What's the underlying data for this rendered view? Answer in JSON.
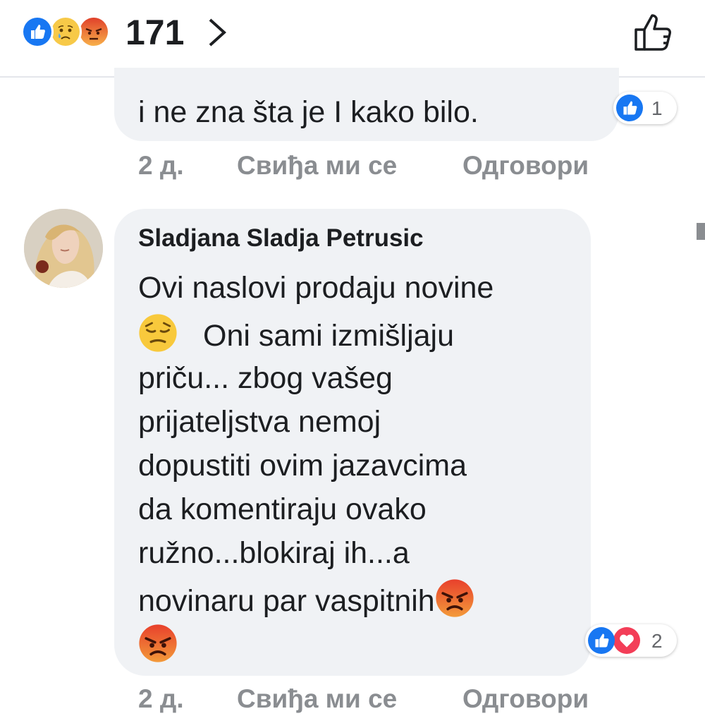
{
  "header": {
    "reaction_count": "171",
    "reaction_icons": [
      "like-icon",
      "sad-icon",
      "angry-icon"
    ],
    "forward_icon": "chevron-right-icon",
    "action_icon": "thumbs-up-outline-icon"
  },
  "comments": [
    {
      "text": "i ne zna šta je I kako bilo.",
      "reactions": {
        "icons": [
          "like-icon"
        ],
        "count": "1"
      },
      "time": "2 д.",
      "like_label": "Свиђа ми се",
      "reply_label": "Одговори"
    },
    {
      "author": "Sladjana Sladja Petrusic",
      "lines": [
        "Ovi naslovi prodaju novine",
        "Oni sami izmišljaju",
        "priču... zbog vašeg",
        "prijateljstva nemoj",
        "dopustiti ovim jazavcima",
        "da komentiraju ovako",
        "ružno...blokiraj ih...a",
        "novinaru par vaspitnih"
      ],
      "emojis": [
        "pensive-face-icon",
        "angry-face-icon",
        "angry-face-icon"
      ],
      "reactions": {
        "icons": [
          "like-icon",
          "love-icon"
        ],
        "count": "2"
      },
      "time": "2 д.",
      "like_label": "Свиђа ми се",
      "reply_label": "Одговори"
    }
  ],
  "colors": {
    "like_blue": "#1877f2",
    "love_red": "#f33e58",
    "angry_orange": "#e9710f",
    "bubble_bg": "#f0f2f5",
    "meta_gray": "#8a8d91"
  }
}
